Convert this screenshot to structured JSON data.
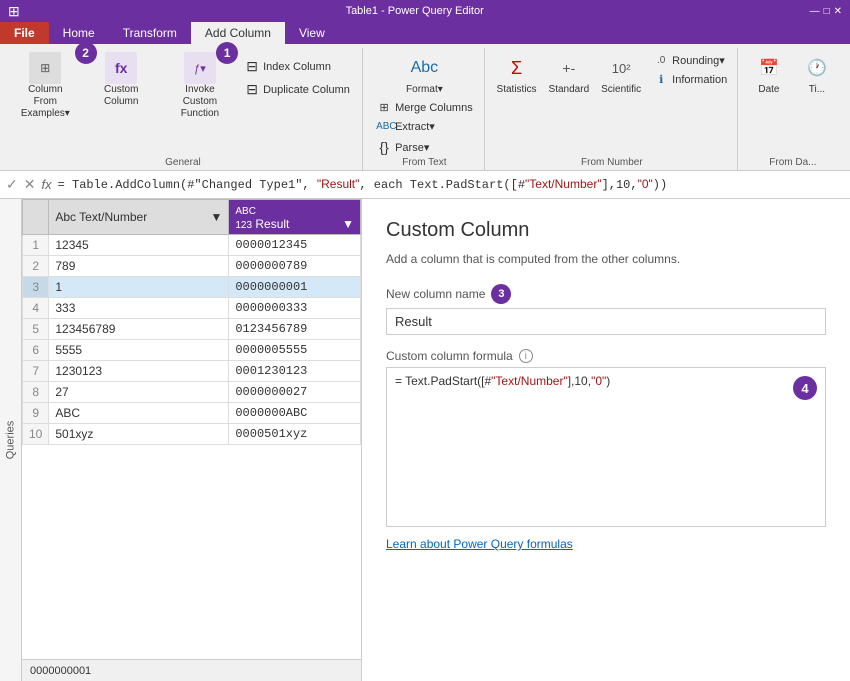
{
  "titleBar": {
    "text": "Table1 - Power Query Editor",
    "icons": [
      "—",
      "□",
      "✕"
    ]
  },
  "ribbon": {
    "tabs": [
      {
        "label": "File",
        "class": "file"
      },
      {
        "label": "Home",
        "class": ""
      },
      {
        "label": "Transform",
        "class": ""
      },
      {
        "label": "Add Column",
        "class": "active"
      },
      {
        "label": "View",
        "class": ""
      }
    ],
    "groups": {
      "general": {
        "label": "General",
        "buttons": [
          {
            "label": "Column From\nExamples▾",
            "icon": "⊞"
          },
          {
            "label": "Custom\nColumn",
            "icon": "fx"
          },
          {
            "label": "Invoke Custom\nFunction",
            "icon": "ƒ"
          }
        ],
        "dropdown": [
          {
            "label": "Index Column"
          },
          {
            "label": "Duplicate Column"
          }
        ],
        "badge": "1",
        "badge2": "2"
      },
      "fromText": {
        "label": "From Text",
        "buttons": [
          {
            "label": "Format▾",
            "icon": "Abc"
          },
          {
            "label": "Merge Columns",
            "icon": "⊞"
          },
          {
            "label": "Extract▾",
            "icon": "ABC"
          },
          {
            "label": "Parse▾",
            "icon": "{}"
          }
        ]
      },
      "fromNumber": {
        "label": "From Number",
        "buttons": [
          {
            "label": "Statistics",
            "icon": "Σ"
          },
          {
            "label": "Standard",
            "icon": "+-"
          },
          {
            "label": "Scientific",
            "icon": "10²"
          },
          {
            "label": "Rounding▾",
            "icon": ".0"
          },
          {
            "label": "Information",
            "icon": "ℹ"
          }
        ]
      },
      "fromDate": {
        "label": "From Da...",
        "buttons": [
          {
            "label": "Date",
            "icon": "📅"
          },
          {
            "label": "Ti...",
            "icon": "🕐"
          }
        ]
      }
    }
  },
  "formulaBar": {
    "formula": "= Table.AddColumn(#\"Changed Type1\", \"Result\", each Text.PadStart([#\"Text/Number\"],10,\"0\"))"
  },
  "table": {
    "columns": [
      {
        "label": "",
        "type": "rownum"
      },
      {
        "label": "Text/Number",
        "type": "text"
      },
      {
        "label": "Result",
        "type": "result"
      }
    ],
    "rows": [
      {
        "num": 1,
        "text": "12345",
        "result": "0000012345"
      },
      {
        "num": 2,
        "text": "789",
        "result": "0000000789"
      },
      {
        "num": 3,
        "text": "1",
        "result": "0000000001",
        "highlight": true
      },
      {
        "num": 4,
        "text": "333",
        "result": "0000000333"
      },
      {
        "num": 5,
        "text": "123456789",
        "result": "0123456789"
      },
      {
        "num": 6,
        "text": "5555",
        "result": "0000005555"
      },
      {
        "num": 7,
        "text": "1230123",
        "result": "0001230123"
      },
      {
        "num": 8,
        "text": "27",
        "result": "0000000027"
      },
      {
        "num": 9,
        "text": "ABC",
        "result": "0000000ABC"
      },
      {
        "num": 10,
        "text": "501xyz",
        "result": "0000501xyz"
      }
    ]
  },
  "statusBar": {
    "value": "0000000001"
  },
  "customColumnPanel": {
    "title": "Custom Column",
    "description": "Add a column that is computed from the other columns.",
    "newColumnNameLabel": "New column name",
    "newColumnNameBadge": "3",
    "columnNameValue": "Result",
    "formulaLabel": "Custom column formula",
    "formulaInfoIcon": "i",
    "formulaBadge": "4",
    "formula": "= Text.PadStart([#\"Text/Number\"],10,\"0\")",
    "learnLink": "Learn about Power Query formulas"
  }
}
